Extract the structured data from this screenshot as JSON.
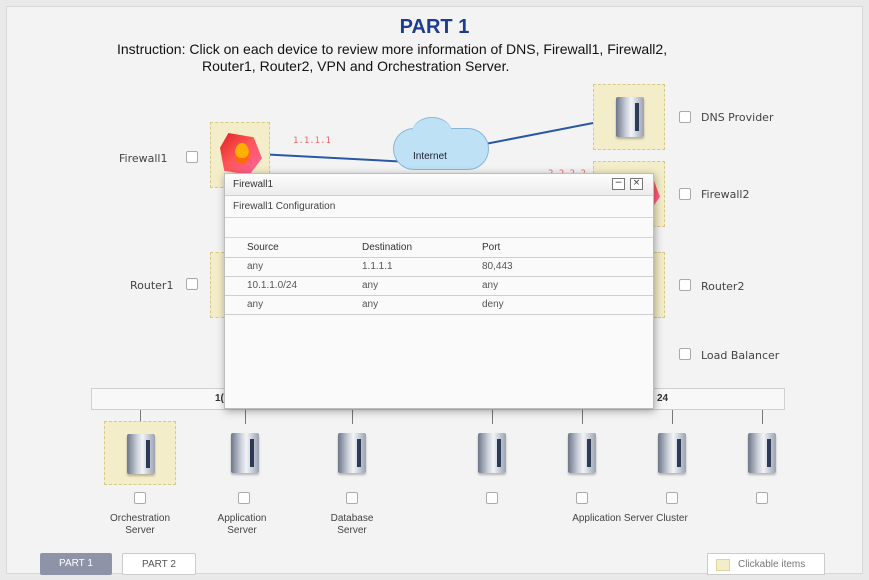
{
  "header": {
    "title": "PART 1",
    "instruction_line1": "Instruction: Click on each device to review more information of DNS, Firewall1, Firewall2,",
    "instruction_line2": "Router1, Router2, VPN and Orchestration Server."
  },
  "devices": {
    "firewall1": "Firewall1",
    "router1": "Router1",
    "dns_provider": "DNS Provider",
    "firewall2": "Firewall2",
    "router2": "Router2",
    "load_balancer": "Load Balancer",
    "internet": "Internet",
    "firewall1_ip": "1.1.1.1",
    "firewall2_ip": "2.2.2.2"
  },
  "bus": {
    "left_fragment": "1(",
    "right_fragment": "24"
  },
  "bottom": {
    "orchestration": [
      "Orchestration",
      "Server"
    ],
    "application": [
      "Application",
      "Server"
    ],
    "database": [
      "Database",
      "Server"
    ],
    "cluster": "Application Server Cluster"
  },
  "dialog": {
    "title": "Firewall1",
    "minimize": "−",
    "close": "×",
    "subtitle": "Firewall1 Configuration",
    "columns": [
      "Source",
      "Destination",
      "Port"
    ],
    "rows": [
      [
        "any",
        "1.1.1.1",
        "80,443"
      ],
      [
        "10.1.1.0/24",
        "any",
        "any"
      ],
      [
        "any",
        "any",
        "deny"
      ]
    ]
  },
  "tabs": [
    "PART 1",
    "PART 2"
  ],
  "legend": {
    "label": "Clickable items"
  },
  "colors": {
    "title": "#1b3c8f",
    "link": "#2b56a6",
    "active_tab": "#8e93a8",
    "highlight": "#f4edc9"
  }
}
